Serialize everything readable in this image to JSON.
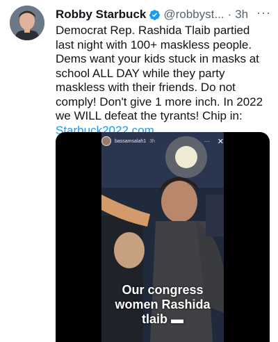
{
  "tweet": {
    "author_name": "Robby Starbuck",
    "handle": "@robbyst...",
    "separator": "·",
    "time": "3h",
    "more": "···",
    "text_main": "Democrat Rep. Rashida Tlaib partied last night with 100+ maskless people. Dems want your kids stuck in masks at school ALL DAY while they party maskless with their friends. Do not comply! Don't give 1 more inch. In 2022 we WILL defeat the tyrants! Chip in: ",
    "link": "Starbuck2022.com"
  },
  "video": {
    "story_username": "bassamsalah1",
    "story_time": "3h",
    "story_more": "···",
    "story_close": "✕",
    "caption_line1": "Our congress",
    "caption_line2": "women Rashida",
    "caption_line3": "tlaib ▬"
  },
  "colors": {
    "link": "#1d9bf0",
    "verified": "#1d9bf0",
    "secondary": "#536471"
  },
  "icons": [
    "verified-badge-icon",
    "more-icon",
    "close-icon"
  ]
}
